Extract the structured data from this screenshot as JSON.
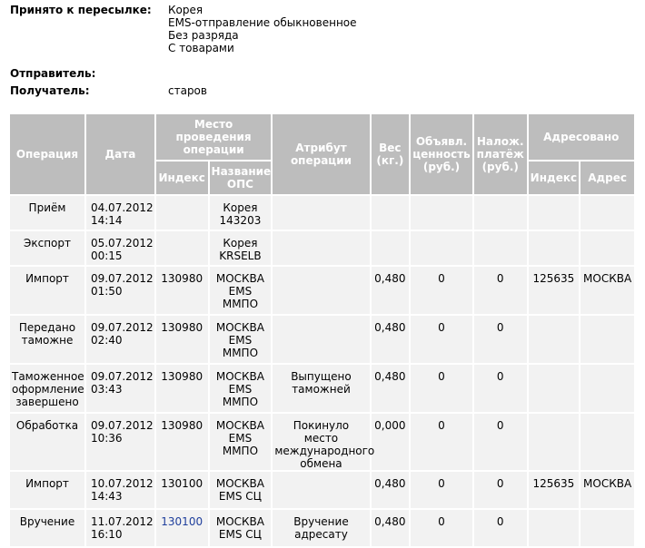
{
  "info": {
    "accepted": {
      "label": "Принято к пересылке:",
      "lines": [
        "Корея",
        "EMS-отправление обыкновенное",
        "Без разряда",
        "С товарами"
      ]
    },
    "sender": {
      "label": "Отправитель:",
      "value": ""
    },
    "recipient": {
      "label": "Получатель:",
      "value": "старов"
    }
  },
  "table": {
    "headers": {
      "operation": "Операция",
      "date": "Дата",
      "place": "Место проведения операции",
      "place_index": "Индекс",
      "place_name": "Название ОПС",
      "attribute": "Атрибут операции",
      "weight": "Вес (кг.)",
      "declared_value": "Объявл. ценность (руб.)",
      "cod": "Налож. платёж (руб.)",
      "addressed": "Адресовано",
      "addr_index": "Индекс",
      "addr_address": "Адрес"
    },
    "rows": [
      {
        "operation": "Приём",
        "date": "04.07.2012 14:14",
        "index": "",
        "name": "Корея 143203",
        "attribute": "",
        "weight": "",
        "value": "",
        "cod": "",
        "addr_index": "",
        "addr": ""
      },
      {
        "operation": "Экспорт",
        "date": "05.07.2012 00:15",
        "index": "",
        "name": "Корея KRSELB",
        "attribute": "",
        "weight": "",
        "value": "",
        "cod": "",
        "addr_index": "",
        "addr": ""
      },
      {
        "operation": "Импорт",
        "date": "09.07.2012 01:50",
        "index": "130980",
        "name": "МОСКВА EMS ММПО",
        "attribute": "",
        "weight": "0,480",
        "value": "0",
        "cod": "0",
        "addr_index": "125635",
        "addr": "МОСКВА"
      },
      {
        "operation": "Передано таможне",
        "date": "09.07.2012 02:40",
        "index": "130980",
        "name": "МОСКВА EMS ММПО",
        "attribute": "",
        "weight": "0,480",
        "value": "0",
        "cod": "0",
        "addr_index": "",
        "addr": ""
      },
      {
        "operation": "Таможенное оформление завершено",
        "date": "09.07.2012 03:43",
        "index": "130980",
        "name": "МОСКВА EMS ММПО",
        "attribute": "Выпущено таможней",
        "weight": "0,480",
        "value": "0",
        "cod": "0",
        "addr_index": "",
        "addr": ""
      },
      {
        "operation": "Обработка",
        "date": "09.07.2012 10:36",
        "index": "130980",
        "name": "МОСКВА EMS ММПО",
        "attribute": "Покинуло место международного обмена",
        "weight": "0,000",
        "value": "0",
        "cod": "0",
        "addr_index": "",
        "addr": ""
      },
      {
        "operation": "Импорт",
        "date": "10.07.2012 14:43",
        "index": "130100",
        "name": "МОСКВА EMS СЦ",
        "attribute": "",
        "weight": "0,480",
        "value": "0",
        "cod": "0",
        "addr_index": "125635",
        "addr": "МОСКВА"
      },
      {
        "operation": "Вручение",
        "date": "11.07.2012 16:10",
        "index": "130100",
        "name": "МОСКВА EMS СЦ",
        "attribute": "Вручение адресату",
        "weight": "0,480",
        "value": "0",
        "cod": "0",
        "addr_index": "",
        "addr": ""
      }
    ]
  },
  "colors": {
    "header_bg": "#bdbdbd",
    "cell_bg": "#f2f2f2",
    "link": "#1f3f9c"
  }
}
